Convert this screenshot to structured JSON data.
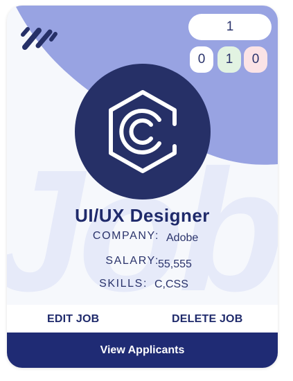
{
  "job": {
    "title": "UI/UX Designer",
    "company_label": "COMPANY:",
    "company": "Adobe",
    "salary_label": "SALARY:",
    "salary": "55,555",
    "skills_label": "SKILLS:",
    "skills": "C,CSS"
  },
  "stats": {
    "total": "1",
    "first": "0",
    "second": "1",
    "third": "0"
  },
  "watermark_text": "Job",
  "actions": {
    "edit_label": "EDIT JOB",
    "delete_label": "DELETE JOB",
    "view_label": "View Applicants"
  },
  "icons": {
    "brand": "slash-stripes-icon",
    "company_logo": "hexagon-c-logo-icon"
  },
  "colors": {
    "accent_blob": "#98a3e2",
    "navy": "#1f2b74",
    "logo_bg": "#263067",
    "stat_green": "#e2f3e2",
    "stat_pink": "#fbe3e6"
  }
}
